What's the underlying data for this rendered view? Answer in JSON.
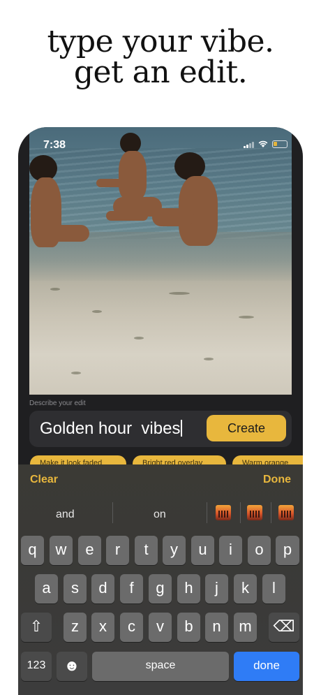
{
  "headline": {
    "line1": "type your vibe.",
    "line2": "get an edit."
  },
  "status": {
    "time": "7:38"
  },
  "editor": {
    "describe_label": "Describe your edit",
    "input_value": "Golden hour  vibes",
    "create_label": "Create",
    "chips": [
      "Make it look faded",
      "Bright red overlay",
      "Warm orange"
    ]
  },
  "keyboard": {
    "clear_label": "Clear",
    "done_label": "Done",
    "suggestions": [
      "and",
      "on"
    ],
    "row1": [
      "q",
      "w",
      "e",
      "r",
      "t",
      "y",
      "u",
      "i",
      "o",
      "p"
    ],
    "row2": [
      "a",
      "s",
      "d",
      "f",
      "g",
      "h",
      "j",
      "k",
      "l"
    ],
    "row3": [
      "z",
      "x",
      "c",
      "v",
      "b",
      "n",
      "m"
    ],
    "shift_glyph": "⇧",
    "delete_glyph": "⌫",
    "numbers_label": "123",
    "emoji_glyph": "☻",
    "space_label": "space",
    "return_label": "done"
  },
  "colors": {
    "accent": "#e8b73d",
    "return_key": "#2f7cf6"
  }
}
